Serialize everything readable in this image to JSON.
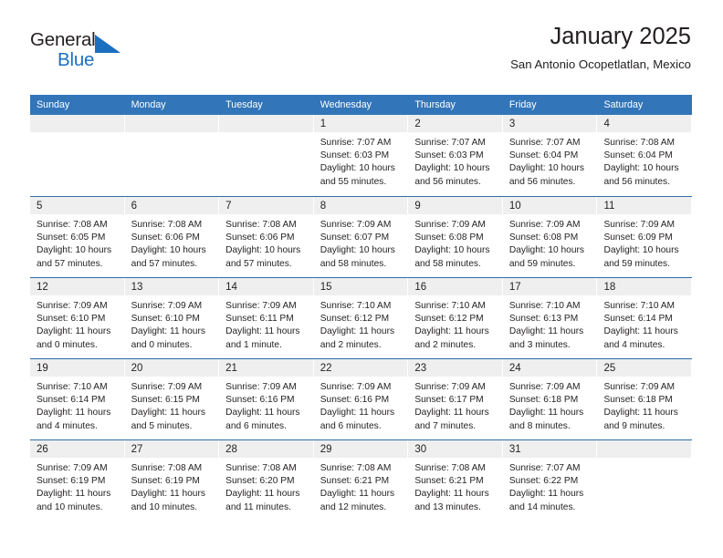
{
  "brand": {
    "name_top": "General",
    "name_bottom": "Blue",
    "accent_color": "#1b6fc0"
  },
  "header": {
    "title": "January 2025",
    "subtitle": "San Antonio Ocopetlatlan, Mexico"
  },
  "colors": {
    "header_row_bg": "#3275b8",
    "daynum_bg": "#efefef",
    "row_divider": "#2f6dab",
    "text": "#231f20"
  },
  "calendar": {
    "weekday_headers": [
      "Sunday",
      "Monday",
      "Tuesday",
      "Wednesday",
      "Thursday",
      "Friday",
      "Saturday"
    ],
    "weeks": [
      [
        {
          "day": "",
          "empty": true,
          "sunrise": "",
          "sunset": "",
          "daylight1": "",
          "daylight2": ""
        },
        {
          "day": "",
          "empty": true,
          "sunrise": "",
          "sunset": "",
          "daylight1": "",
          "daylight2": ""
        },
        {
          "day": "",
          "empty": true,
          "sunrise": "",
          "sunset": "",
          "daylight1": "",
          "daylight2": ""
        },
        {
          "day": "1",
          "empty": false,
          "sunrise": "Sunrise: 7:07 AM",
          "sunset": "Sunset: 6:03 PM",
          "daylight1": "Daylight: 10 hours",
          "daylight2": "and 55 minutes."
        },
        {
          "day": "2",
          "empty": false,
          "sunrise": "Sunrise: 7:07 AM",
          "sunset": "Sunset: 6:03 PM",
          "daylight1": "Daylight: 10 hours",
          "daylight2": "and 56 minutes."
        },
        {
          "day": "3",
          "empty": false,
          "sunrise": "Sunrise: 7:07 AM",
          "sunset": "Sunset: 6:04 PM",
          "daylight1": "Daylight: 10 hours",
          "daylight2": "and 56 minutes."
        },
        {
          "day": "4",
          "empty": false,
          "sunrise": "Sunrise: 7:08 AM",
          "sunset": "Sunset: 6:04 PM",
          "daylight1": "Daylight: 10 hours",
          "daylight2": "and 56 minutes."
        }
      ],
      [
        {
          "day": "5",
          "empty": false,
          "sunrise": "Sunrise: 7:08 AM",
          "sunset": "Sunset: 6:05 PM",
          "daylight1": "Daylight: 10 hours",
          "daylight2": "and 57 minutes."
        },
        {
          "day": "6",
          "empty": false,
          "sunrise": "Sunrise: 7:08 AM",
          "sunset": "Sunset: 6:06 PM",
          "daylight1": "Daylight: 10 hours",
          "daylight2": "and 57 minutes."
        },
        {
          "day": "7",
          "empty": false,
          "sunrise": "Sunrise: 7:08 AM",
          "sunset": "Sunset: 6:06 PM",
          "daylight1": "Daylight: 10 hours",
          "daylight2": "and 57 minutes."
        },
        {
          "day": "8",
          "empty": false,
          "sunrise": "Sunrise: 7:09 AM",
          "sunset": "Sunset: 6:07 PM",
          "daylight1": "Daylight: 10 hours",
          "daylight2": "and 58 minutes."
        },
        {
          "day": "9",
          "empty": false,
          "sunrise": "Sunrise: 7:09 AM",
          "sunset": "Sunset: 6:08 PM",
          "daylight1": "Daylight: 10 hours",
          "daylight2": "and 58 minutes."
        },
        {
          "day": "10",
          "empty": false,
          "sunrise": "Sunrise: 7:09 AM",
          "sunset": "Sunset: 6:08 PM",
          "daylight1": "Daylight: 10 hours",
          "daylight2": "and 59 minutes."
        },
        {
          "day": "11",
          "empty": false,
          "sunrise": "Sunrise: 7:09 AM",
          "sunset": "Sunset: 6:09 PM",
          "daylight1": "Daylight: 10 hours",
          "daylight2": "and 59 minutes."
        }
      ],
      [
        {
          "day": "12",
          "empty": false,
          "sunrise": "Sunrise: 7:09 AM",
          "sunset": "Sunset: 6:10 PM",
          "daylight1": "Daylight: 11 hours",
          "daylight2": "and 0 minutes."
        },
        {
          "day": "13",
          "empty": false,
          "sunrise": "Sunrise: 7:09 AM",
          "sunset": "Sunset: 6:10 PM",
          "daylight1": "Daylight: 11 hours",
          "daylight2": "and 0 minutes."
        },
        {
          "day": "14",
          "empty": false,
          "sunrise": "Sunrise: 7:09 AM",
          "sunset": "Sunset: 6:11 PM",
          "daylight1": "Daylight: 11 hours",
          "daylight2": "and 1 minute."
        },
        {
          "day": "15",
          "empty": false,
          "sunrise": "Sunrise: 7:10 AM",
          "sunset": "Sunset: 6:12 PM",
          "daylight1": "Daylight: 11 hours",
          "daylight2": "and 2 minutes."
        },
        {
          "day": "16",
          "empty": false,
          "sunrise": "Sunrise: 7:10 AM",
          "sunset": "Sunset: 6:12 PM",
          "daylight1": "Daylight: 11 hours",
          "daylight2": "and 2 minutes."
        },
        {
          "day": "17",
          "empty": false,
          "sunrise": "Sunrise: 7:10 AM",
          "sunset": "Sunset: 6:13 PM",
          "daylight1": "Daylight: 11 hours",
          "daylight2": "and 3 minutes."
        },
        {
          "day": "18",
          "empty": false,
          "sunrise": "Sunrise: 7:10 AM",
          "sunset": "Sunset: 6:14 PM",
          "daylight1": "Daylight: 11 hours",
          "daylight2": "and 4 minutes."
        }
      ],
      [
        {
          "day": "19",
          "empty": false,
          "sunrise": "Sunrise: 7:10 AM",
          "sunset": "Sunset: 6:14 PM",
          "daylight1": "Daylight: 11 hours",
          "daylight2": "and 4 minutes."
        },
        {
          "day": "20",
          "empty": false,
          "sunrise": "Sunrise: 7:09 AM",
          "sunset": "Sunset: 6:15 PM",
          "daylight1": "Daylight: 11 hours",
          "daylight2": "and 5 minutes."
        },
        {
          "day": "21",
          "empty": false,
          "sunrise": "Sunrise: 7:09 AM",
          "sunset": "Sunset: 6:16 PM",
          "daylight1": "Daylight: 11 hours",
          "daylight2": "and 6 minutes."
        },
        {
          "day": "22",
          "empty": false,
          "sunrise": "Sunrise: 7:09 AM",
          "sunset": "Sunset: 6:16 PM",
          "daylight1": "Daylight: 11 hours",
          "daylight2": "and 6 minutes."
        },
        {
          "day": "23",
          "empty": false,
          "sunrise": "Sunrise: 7:09 AM",
          "sunset": "Sunset: 6:17 PM",
          "daylight1": "Daylight: 11 hours",
          "daylight2": "and 7 minutes."
        },
        {
          "day": "24",
          "empty": false,
          "sunrise": "Sunrise: 7:09 AM",
          "sunset": "Sunset: 6:18 PM",
          "daylight1": "Daylight: 11 hours",
          "daylight2": "and 8 minutes."
        },
        {
          "day": "25",
          "empty": false,
          "sunrise": "Sunrise: 7:09 AM",
          "sunset": "Sunset: 6:18 PM",
          "daylight1": "Daylight: 11 hours",
          "daylight2": "and 9 minutes."
        }
      ],
      [
        {
          "day": "26",
          "empty": false,
          "sunrise": "Sunrise: 7:09 AM",
          "sunset": "Sunset: 6:19 PM",
          "daylight1": "Daylight: 11 hours",
          "daylight2": "and 10 minutes."
        },
        {
          "day": "27",
          "empty": false,
          "sunrise": "Sunrise: 7:08 AM",
          "sunset": "Sunset: 6:19 PM",
          "daylight1": "Daylight: 11 hours",
          "daylight2": "and 10 minutes."
        },
        {
          "day": "28",
          "empty": false,
          "sunrise": "Sunrise: 7:08 AM",
          "sunset": "Sunset: 6:20 PM",
          "daylight1": "Daylight: 11 hours",
          "daylight2": "and 11 minutes."
        },
        {
          "day": "29",
          "empty": false,
          "sunrise": "Sunrise: 7:08 AM",
          "sunset": "Sunset: 6:21 PM",
          "daylight1": "Daylight: 11 hours",
          "daylight2": "and 12 minutes."
        },
        {
          "day": "30",
          "empty": false,
          "sunrise": "Sunrise: 7:08 AM",
          "sunset": "Sunset: 6:21 PM",
          "daylight1": "Daylight: 11 hours",
          "daylight2": "and 13 minutes."
        },
        {
          "day": "31",
          "empty": false,
          "sunrise": "Sunrise: 7:07 AM",
          "sunset": "Sunset: 6:22 PM",
          "daylight1": "Daylight: 11 hours",
          "daylight2": "and 14 minutes."
        },
        {
          "day": "",
          "empty": true,
          "sunrise": "",
          "sunset": "",
          "daylight1": "",
          "daylight2": ""
        }
      ]
    ]
  }
}
